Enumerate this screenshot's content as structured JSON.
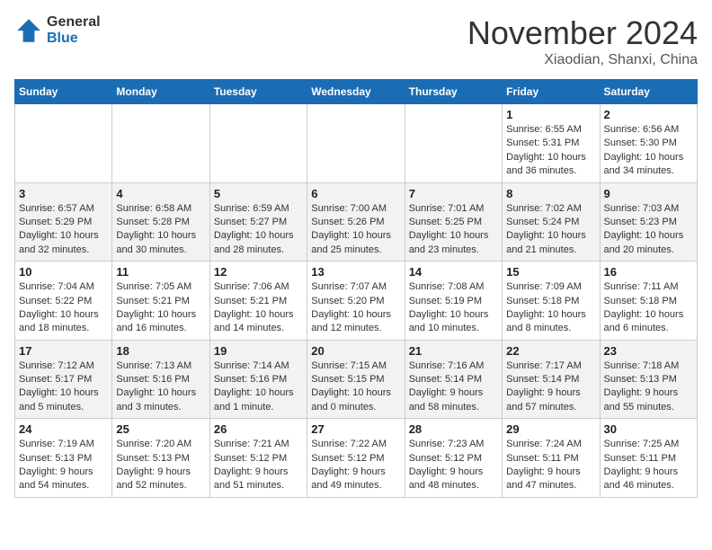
{
  "header": {
    "logo_general": "General",
    "logo_blue": "Blue",
    "month_title": "November 2024",
    "location": "Xiaodian, Shanxi, China"
  },
  "days_of_week": [
    "Sunday",
    "Monday",
    "Tuesday",
    "Wednesday",
    "Thursday",
    "Friday",
    "Saturday"
  ],
  "weeks": [
    [
      {
        "day": "",
        "info": ""
      },
      {
        "day": "",
        "info": ""
      },
      {
        "day": "",
        "info": ""
      },
      {
        "day": "",
        "info": ""
      },
      {
        "day": "",
        "info": ""
      },
      {
        "day": "1",
        "info": "Sunrise: 6:55 AM\nSunset: 5:31 PM\nDaylight: 10 hours and 36 minutes."
      },
      {
        "day": "2",
        "info": "Sunrise: 6:56 AM\nSunset: 5:30 PM\nDaylight: 10 hours and 34 minutes."
      }
    ],
    [
      {
        "day": "3",
        "info": "Sunrise: 6:57 AM\nSunset: 5:29 PM\nDaylight: 10 hours and 32 minutes."
      },
      {
        "day": "4",
        "info": "Sunrise: 6:58 AM\nSunset: 5:28 PM\nDaylight: 10 hours and 30 minutes."
      },
      {
        "day": "5",
        "info": "Sunrise: 6:59 AM\nSunset: 5:27 PM\nDaylight: 10 hours and 28 minutes."
      },
      {
        "day": "6",
        "info": "Sunrise: 7:00 AM\nSunset: 5:26 PM\nDaylight: 10 hours and 25 minutes."
      },
      {
        "day": "7",
        "info": "Sunrise: 7:01 AM\nSunset: 5:25 PM\nDaylight: 10 hours and 23 minutes."
      },
      {
        "day": "8",
        "info": "Sunrise: 7:02 AM\nSunset: 5:24 PM\nDaylight: 10 hours and 21 minutes."
      },
      {
        "day": "9",
        "info": "Sunrise: 7:03 AM\nSunset: 5:23 PM\nDaylight: 10 hours and 20 minutes."
      }
    ],
    [
      {
        "day": "10",
        "info": "Sunrise: 7:04 AM\nSunset: 5:22 PM\nDaylight: 10 hours and 18 minutes."
      },
      {
        "day": "11",
        "info": "Sunrise: 7:05 AM\nSunset: 5:21 PM\nDaylight: 10 hours and 16 minutes."
      },
      {
        "day": "12",
        "info": "Sunrise: 7:06 AM\nSunset: 5:21 PM\nDaylight: 10 hours and 14 minutes."
      },
      {
        "day": "13",
        "info": "Sunrise: 7:07 AM\nSunset: 5:20 PM\nDaylight: 10 hours and 12 minutes."
      },
      {
        "day": "14",
        "info": "Sunrise: 7:08 AM\nSunset: 5:19 PM\nDaylight: 10 hours and 10 minutes."
      },
      {
        "day": "15",
        "info": "Sunrise: 7:09 AM\nSunset: 5:18 PM\nDaylight: 10 hours and 8 minutes."
      },
      {
        "day": "16",
        "info": "Sunrise: 7:11 AM\nSunset: 5:18 PM\nDaylight: 10 hours and 6 minutes."
      }
    ],
    [
      {
        "day": "17",
        "info": "Sunrise: 7:12 AM\nSunset: 5:17 PM\nDaylight: 10 hours and 5 minutes."
      },
      {
        "day": "18",
        "info": "Sunrise: 7:13 AM\nSunset: 5:16 PM\nDaylight: 10 hours and 3 minutes."
      },
      {
        "day": "19",
        "info": "Sunrise: 7:14 AM\nSunset: 5:16 PM\nDaylight: 10 hours and 1 minute."
      },
      {
        "day": "20",
        "info": "Sunrise: 7:15 AM\nSunset: 5:15 PM\nDaylight: 10 hours and 0 minutes."
      },
      {
        "day": "21",
        "info": "Sunrise: 7:16 AM\nSunset: 5:14 PM\nDaylight: 9 hours and 58 minutes."
      },
      {
        "day": "22",
        "info": "Sunrise: 7:17 AM\nSunset: 5:14 PM\nDaylight: 9 hours and 57 minutes."
      },
      {
        "day": "23",
        "info": "Sunrise: 7:18 AM\nSunset: 5:13 PM\nDaylight: 9 hours and 55 minutes."
      }
    ],
    [
      {
        "day": "24",
        "info": "Sunrise: 7:19 AM\nSunset: 5:13 PM\nDaylight: 9 hours and 54 minutes."
      },
      {
        "day": "25",
        "info": "Sunrise: 7:20 AM\nSunset: 5:13 PM\nDaylight: 9 hours and 52 minutes."
      },
      {
        "day": "26",
        "info": "Sunrise: 7:21 AM\nSunset: 5:12 PM\nDaylight: 9 hours and 51 minutes."
      },
      {
        "day": "27",
        "info": "Sunrise: 7:22 AM\nSunset: 5:12 PM\nDaylight: 9 hours and 49 minutes."
      },
      {
        "day": "28",
        "info": "Sunrise: 7:23 AM\nSunset: 5:12 PM\nDaylight: 9 hours and 48 minutes."
      },
      {
        "day": "29",
        "info": "Sunrise: 7:24 AM\nSunset: 5:11 PM\nDaylight: 9 hours and 47 minutes."
      },
      {
        "day": "30",
        "info": "Sunrise: 7:25 AM\nSunset: 5:11 PM\nDaylight: 9 hours and 46 minutes."
      }
    ]
  ]
}
